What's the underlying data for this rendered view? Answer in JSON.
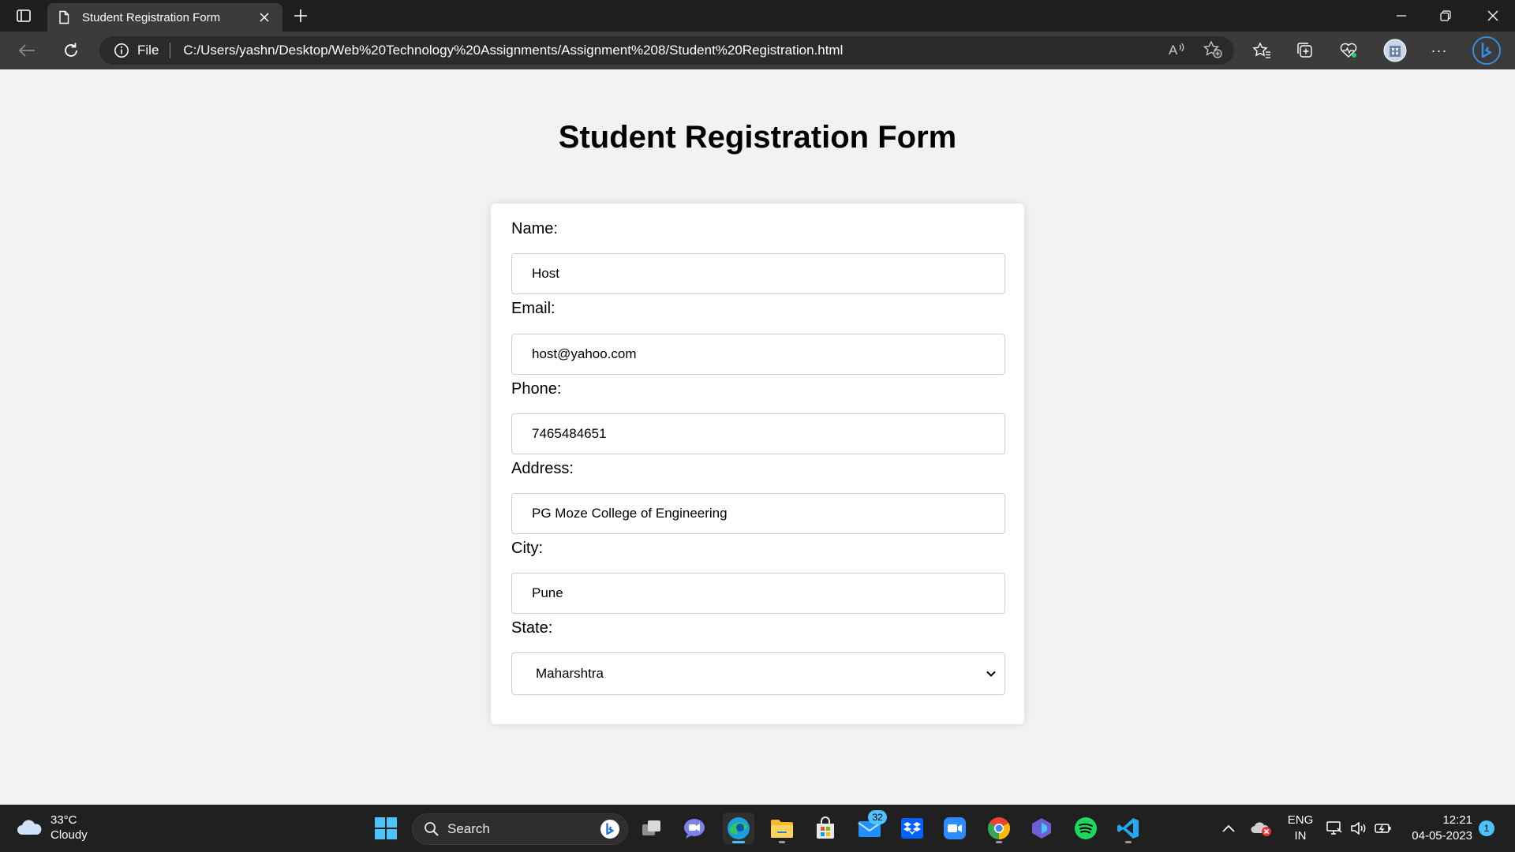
{
  "browser": {
    "tab": {
      "title": "Student Registration Form"
    },
    "address": {
      "scheme": "File",
      "url": "C:/Users/yashn/Desktop/Web%20Technology%20Assignments/Assignment%208/Student%20Registration.html"
    },
    "read_aloud_label": "A",
    "more_label": "···"
  },
  "page": {
    "heading": "Student Registration Form",
    "form": {
      "name": {
        "label": "Name:",
        "value": "Host"
      },
      "email": {
        "label": "Email:",
        "value": "host@yahoo.com"
      },
      "phone": {
        "label": "Phone:",
        "value": "7465484651"
      },
      "address": {
        "label": "Address:",
        "value": "PG Moze College of Engineering"
      },
      "city": {
        "label": "City:",
        "value": "Pune"
      },
      "state": {
        "label": "State:",
        "selected": "Maharshtra"
      }
    }
  },
  "taskbar": {
    "weather": {
      "temp": "33°C",
      "condition": "Cloudy"
    },
    "search_label": "Search",
    "mail_badge": "32",
    "language": {
      "line1": "ENG",
      "line2": "IN"
    },
    "clock": {
      "time": "12:21",
      "date": "04-05-2023"
    },
    "notification_count": "1"
  },
  "colors": {
    "accent": "#4cc2ff",
    "page_bg": "#f2f2f2",
    "card_bg": "#ffffff",
    "chrome_dark": "#1f1f1f",
    "toolbar": "#3b3b3b"
  }
}
